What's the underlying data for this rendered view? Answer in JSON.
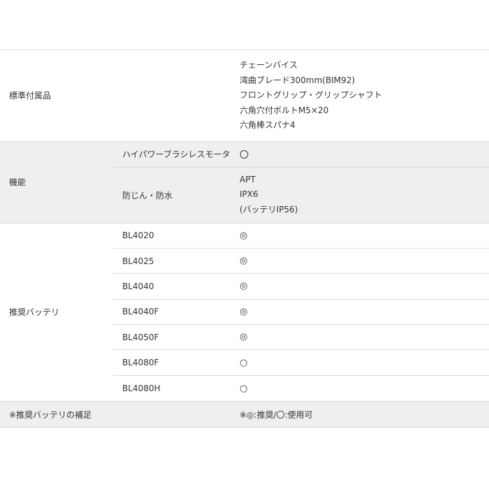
{
  "accessories": {
    "label": "標準付属品",
    "items": [
      "チェーンバイス",
      "湾曲ブレード300mm(BIM92)",
      "フロントグリップ・グリップシャフト",
      "六角穴付ボルトM5×20",
      "六角棒スパナ4"
    ]
  },
  "features": {
    "label": "機能",
    "rows": [
      {
        "label": "ハイパワーブラシレスモータ",
        "values": [
          "〇"
        ]
      },
      {
        "label": "防じん・防水",
        "values": [
          "APT",
          "IPX6",
          "(バッテリIP56)"
        ]
      }
    ]
  },
  "batteries": {
    "label": "推奨バッテリ",
    "rows": [
      {
        "label": "BL4020",
        "value": "◎"
      },
      {
        "label": "BL4025",
        "value": "◎"
      },
      {
        "label": "BL4040",
        "value": "◎"
      },
      {
        "label": "BL4040F",
        "value": "◎"
      },
      {
        "label": "BL4050F",
        "value": "◎"
      },
      {
        "label": "BL4080F",
        "value": "○"
      },
      {
        "label": "BL4080H",
        "value": "○"
      }
    ]
  },
  "note": {
    "label": "※推奨バッテリの補足",
    "value": "※◎:推奨/〇:使用可"
  }
}
